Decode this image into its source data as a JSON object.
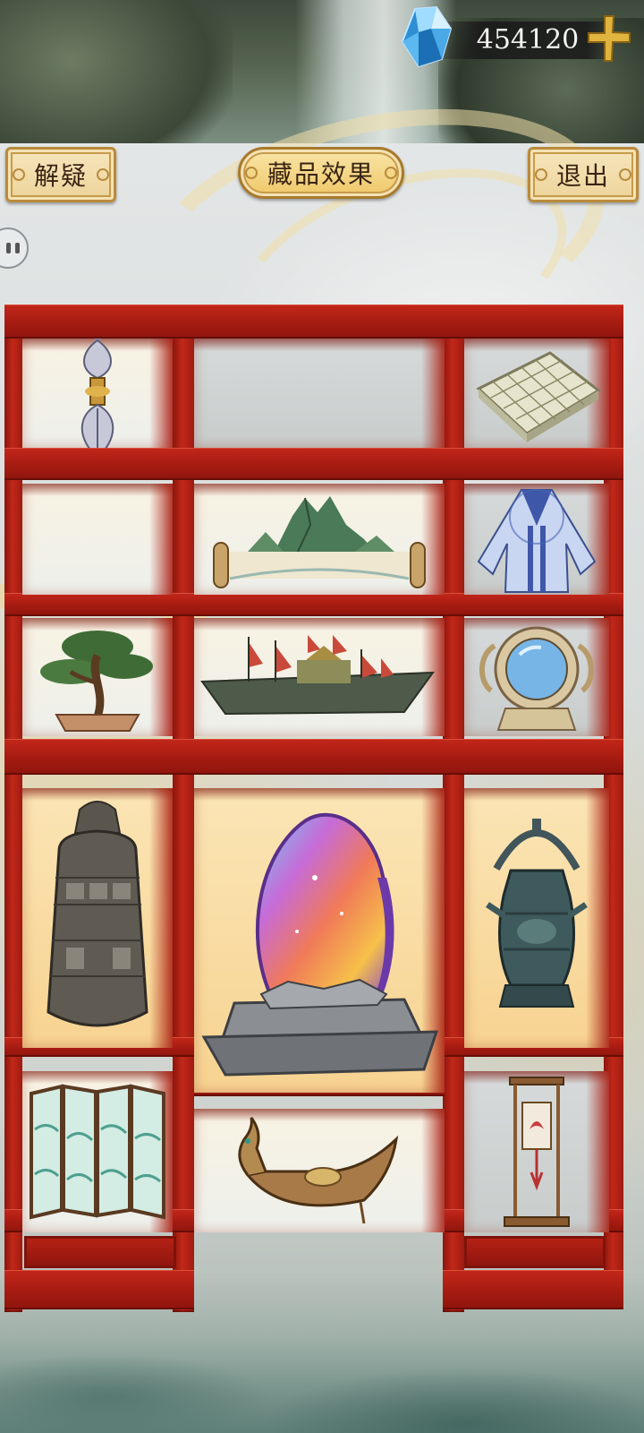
{
  "currency": {
    "amount": "454120",
    "icon": "blue-crystal-gem-icon",
    "add_icon": "gold-plus-icon"
  },
  "buttons": {
    "hint": "解疑",
    "effect": "藏品效果",
    "exit": "退出"
  },
  "side_toggle": {
    "icon": "pause-icon"
  },
  "colors": {
    "shelf_red": "#b21f14",
    "button_gold": "#efd39a",
    "text_dark": "#3a2413",
    "gem_blue": "#58b8ec"
  },
  "collection": [
    {
      "slot": "r1-c1",
      "item": "vajra-scepter",
      "icon": "vajra-icon"
    },
    {
      "slot": "r1-c2",
      "item": "empty",
      "icon": ""
    },
    {
      "slot": "r1-c3",
      "item": "go-board",
      "icon": "go-board-icon"
    },
    {
      "slot": "r2-c1",
      "item": "empty",
      "icon": ""
    },
    {
      "slot": "r2-c2",
      "item": "landscape-scroll",
      "icon": "scroll-painting-icon"
    },
    {
      "slot": "r2-c3",
      "item": "blue-robe",
      "icon": "robe-icon"
    },
    {
      "slot": "r3-c1",
      "item": "bonsai-pine",
      "icon": "bonsai-icon"
    },
    {
      "slot": "r3-c2",
      "item": "treasure-ship",
      "icon": "junk-ship-icon"
    },
    {
      "slot": "r3-c3",
      "item": "dragon-mirror",
      "icon": "mirror-icon"
    },
    {
      "slot": "r4-c1",
      "item": "bronze-bell",
      "icon": "bell-icon"
    },
    {
      "slot": "r4-c2",
      "item": "rainbow-stone",
      "icon": "rainbow-crystal-icon"
    },
    {
      "slot": "r4-c3",
      "item": "bronze-teapot",
      "icon": "bronze-pot-icon"
    },
    {
      "slot": "r5-c1",
      "item": "folding-screen",
      "icon": "folding-screen-icon"
    },
    {
      "slot": "r5-c2",
      "item": "dragon-boat",
      "icon": "dragon-boat-icon"
    },
    {
      "slot": "r5-c3",
      "item": "hanging-lantern",
      "icon": "lantern-icon"
    }
  ]
}
